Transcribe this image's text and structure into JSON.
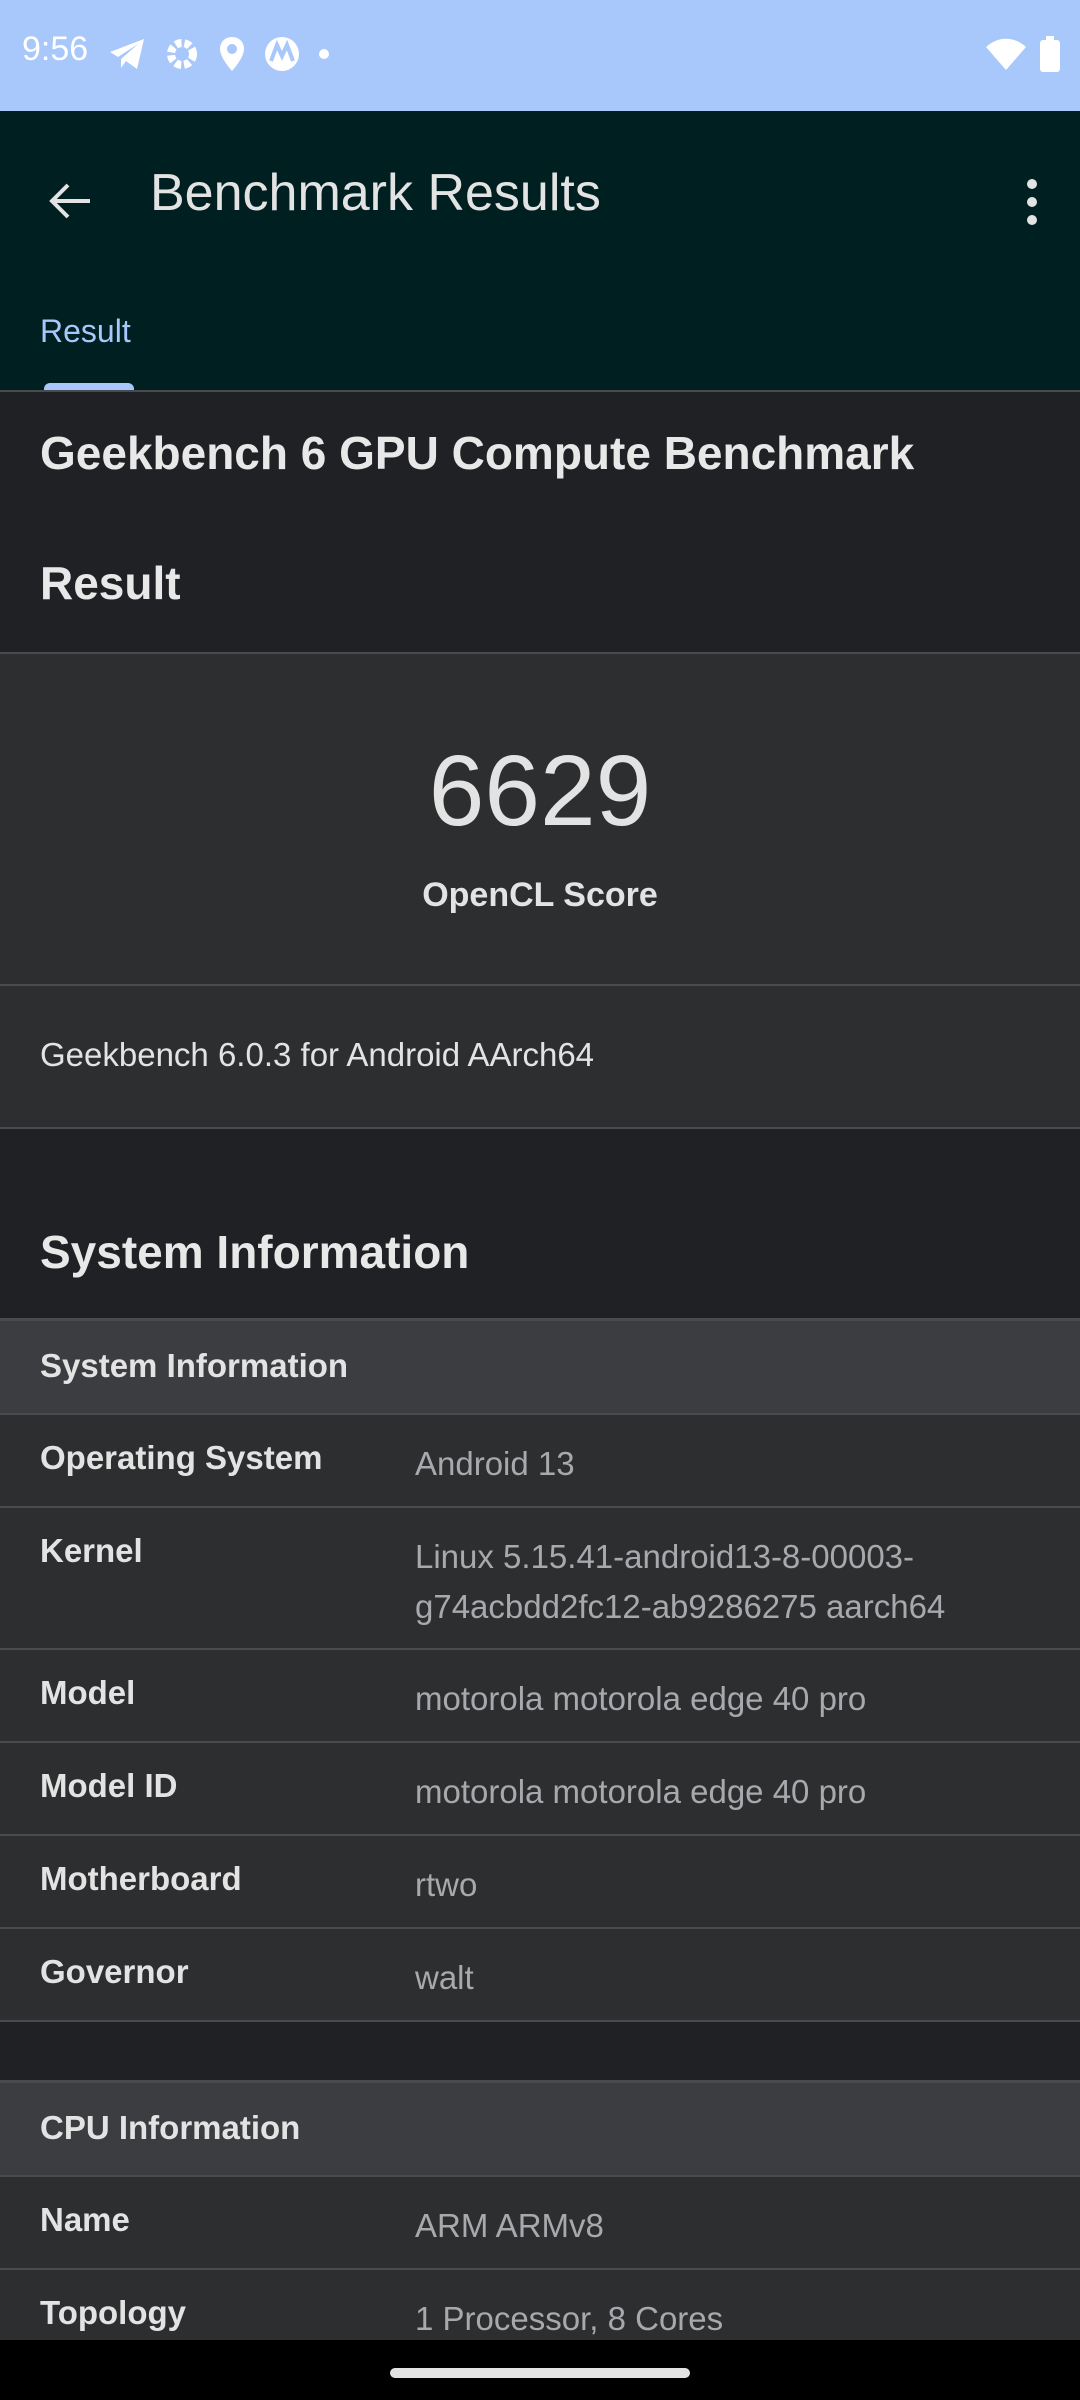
{
  "status_bar": {
    "time": "9:56",
    "icons": [
      "telegram-icon",
      "settings-icon",
      "location-icon",
      "motorola-icon",
      "dot-icon",
      "wifi-icon",
      "battery-icon"
    ]
  },
  "app_bar": {
    "title": "Benchmark Results",
    "tab_label": "Result"
  },
  "benchmark": {
    "title": "Geekbench 6 GPU Compute Benchmark",
    "result_heading": "Result",
    "score": "6629",
    "score_label": "OpenCL Score",
    "version": "Geekbench 6.0.3 for Android AArch64"
  },
  "system_info": {
    "heading": "System Information",
    "table_header": "System Information",
    "rows": [
      {
        "key": "Operating System",
        "value": "Android 13"
      },
      {
        "key": "Kernel",
        "value": "Linux 5.15.41-android13-8-00003-g74acbdd2fc12-ab9286275 aarch64"
      },
      {
        "key": "Model",
        "value": "motorola motorola edge 40 pro"
      },
      {
        "key": "Model ID",
        "value": "motorola motorola edge 40 pro"
      },
      {
        "key": "Motherboard",
        "value": "rtwo"
      },
      {
        "key": "Governor",
        "value": "walt"
      }
    ]
  },
  "cpu_info": {
    "table_header": "CPU Information",
    "rows": [
      {
        "key": "Name",
        "value": "ARM ARMv8"
      },
      {
        "key": "Topology",
        "value": "1 Processor, 8 Cores"
      }
    ]
  },
  "colors": {
    "status_bar": "#a8c7fa",
    "app_bar": "#001f21",
    "accent": "#a8c7fa",
    "background": "#202124",
    "card": "#2d2e30"
  }
}
